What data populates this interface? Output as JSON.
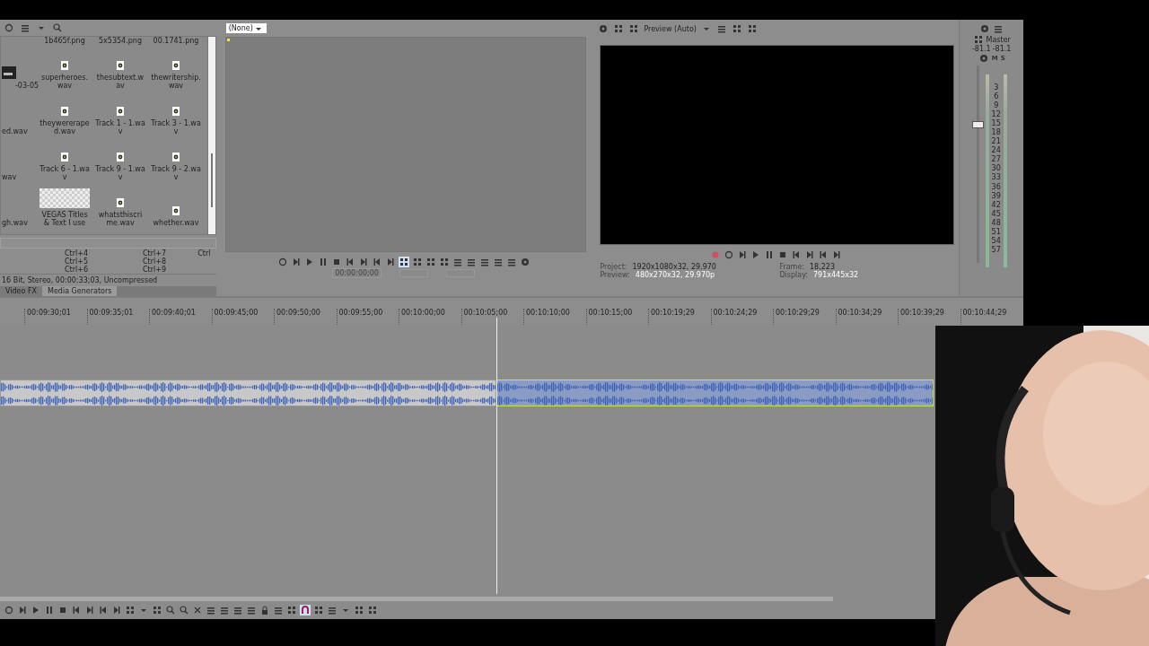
{
  "media_bin": {
    "top_labels": [
      "1b465f.png",
      "5x5354.png",
      "00.1741.png"
    ],
    "items": [
      {
        "label": "-03-05",
        "kind": "video"
      },
      {
        "label": "superheroes.wav",
        "kind": "audio"
      },
      {
        "label": "thesubtext.wav",
        "kind": "audio"
      },
      {
        "label": "thewritership.wav",
        "kind": "audio"
      },
      {
        "label": "ed.wav",
        "kind": "cut"
      },
      {
        "label": "theywereraped.wav",
        "kind": "audio"
      },
      {
        "label": "Track 1 - 1.wav",
        "kind": "audio"
      },
      {
        "label": "Track 3 - 1.wav",
        "kind": "audio"
      },
      {
        "label": "wav",
        "kind": "cut"
      },
      {
        "label": "Track 6 - 1.wav",
        "kind": "audio"
      },
      {
        "label": "Track 9 - 1.wav",
        "kind": "audio"
      },
      {
        "label": "Track 9 - 2.wav",
        "kind": "audio"
      },
      {
        "label": "gh.wav",
        "kind": "cut"
      },
      {
        "label": "VEGAS Titles & Text I use",
        "kind": "title"
      },
      {
        "label": "whatsthiscrime.wav",
        "kind": "audio"
      },
      {
        "label": "whether.wav",
        "kind": "audio"
      }
    ],
    "shortcuts": [
      [
        "Ctrl+4",
        "Ctrl+5",
        "Ctrl+6"
      ],
      [
        "Ctrl+7",
        "Ctrl+8",
        "Ctrl+9"
      ],
      [
        "Ctrl"
      ]
    ],
    "status": "16 Bit, Stereo, 00:00:33;03, Uncompressed",
    "tabs": [
      {
        "label": "Video FX",
        "selected": false
      },
      {
        "label": "Media Generators",
        "selected": true
      }
    ]
  },
  "trimmer": {
    "source": "(None)",
    "time": "00:00:00;00"
  },
  "preview": {
    "quality": "Preview (Auto)",
    "info": [
      {
        "label": "Project:",
        "value": "1920x1080x32, 29.970"
      },
      {
        "label": "Preview:",
        "value": "480x270x32, 29.970p"
      },
      {
        "label": "Frame:",
        "value": "18,223"
      },
      {
        "label": "Display:",
        "value": "791x445x32"
      }
    ]
  },
  "mixer": {
    "title": "Master",
    "mute": "M",
    "solo": "S",
    "peaks": [
      "-81.1",
      "-81.1"
    ],
    "scale": [
      "3",
      "6",
      "9",
      "12",
      "15",
      "18",
      "21",
      "24",
      "27",
      "30",
      "33",
      "36",
      "39",
      "42",
      "45",
      "48",
      "51",
      "54",
      "57"
    ],
    "fader": {
      "level": 0.68
    }
  },
  "timeline": {
    "ruler": [
      "00:09:30;01",
      "00:09:35;01",
      "00:09:40;01",
      "00:09:45;00",
      "00:09:50;00",
      "00:09:55;00",
      "00:10:00;00",
      "00:10:05;00",
      "00:10:10;00",
      "00:10:15;00",
      "00:10:19;29",
      "00:10:24;29",
      "00:10:29;29",
      "00:10:34;29",
      "00:10:39;29",
      "00:10:44;29"
    ],
    "events": [
      {
        "selected": false
      },
      {
        "selected": true
      }
    ]
  }
}
